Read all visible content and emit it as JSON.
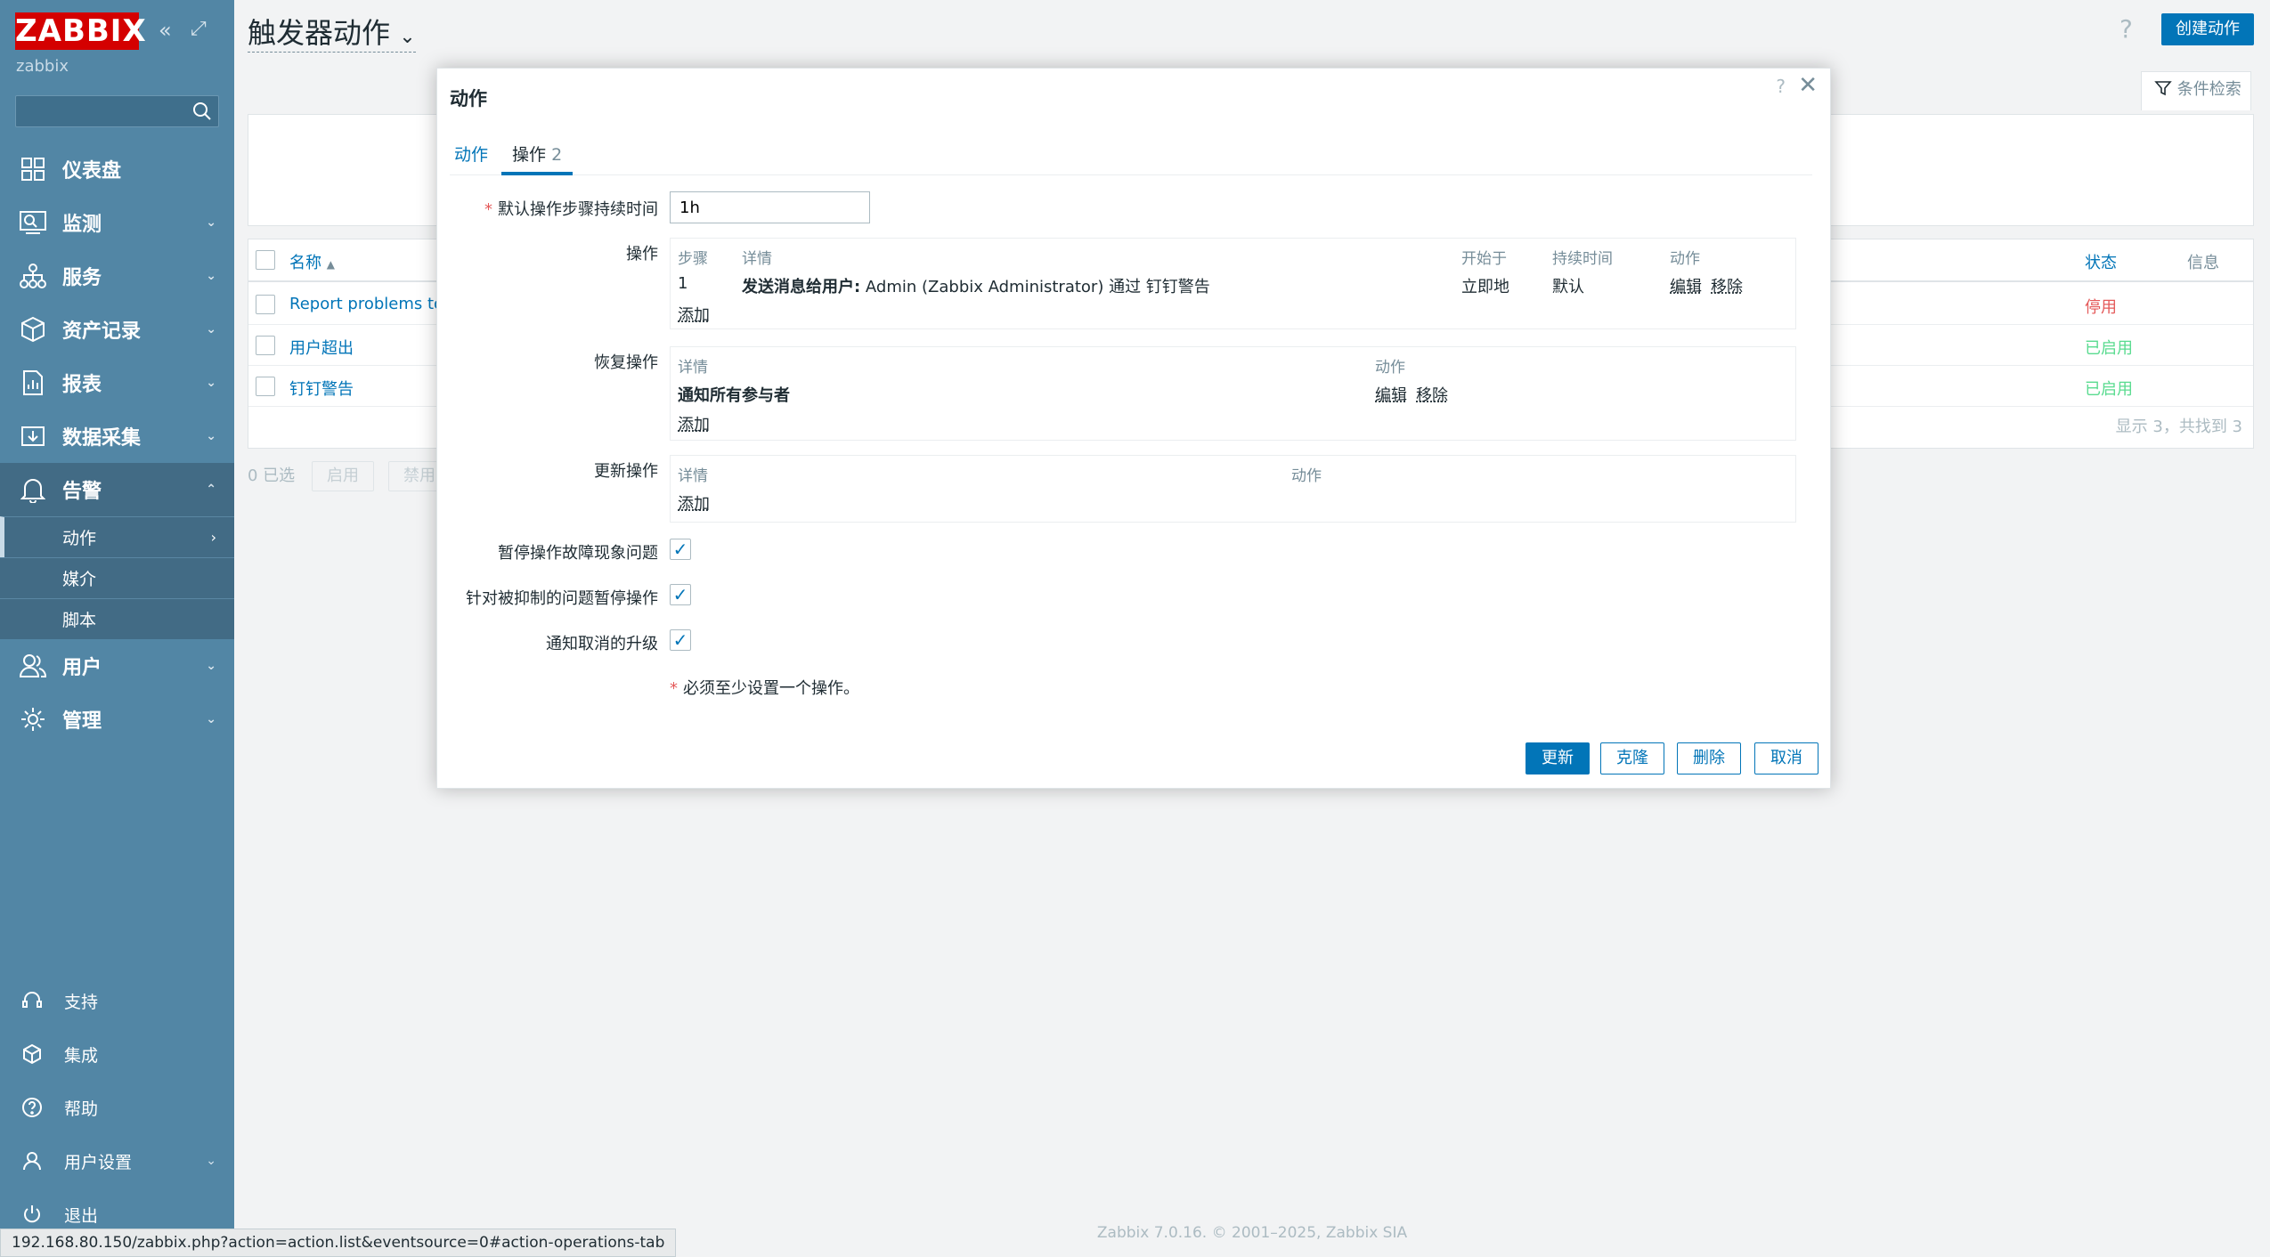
{
  "sidebar": {
    "logo": "ZABBIX",
    "server_name": "zabbix",
    "search_placeholder": "",
    "menu": [
      {
        "label": "仪表盘"
      },
      {
        "label": "监测"
      },
      {
        "label": "服务"
      },
      {
        "label": "资产记录"
      },
      {
        "label": "报表"
      },
      {
        "label": "数据采集"
      },
      {
        "label": "告警"
      },
      {
        "label": "用户"
      },
      {
        "label": "管理"
      }
    ],
    "alerts_submenu": [
      {
        "label": "动作"
      },
      {
        "label": "媒介"
      },
      {
        "label": "脚本"
      }
    ],
    "bottom": [
      {
        "label": "支持"
      },
      {
        "label": "集成"
      },
      {
        "label": "帮助"
      },
      {
        "label": "用户设置"
      },
      {
        "label": "退出"
      }
    ]
  },
  "header": {
    "title": "触发器动作",
    "help": "?",
    "create_button": "创建动作",
    "filter_tab": "条件检索"
  },
  "list": {
    "col_name": "名称",
    "col_status": "状态",
    "col_info": "信息",
    "rows": [
      {
        "name": "Report problems to Z",
        "status": "停用"
      },
      {
        "name": "用户超出",
        "status": "已启用"
      },
      {
        "name": "钉钉警告",
        "status": "已启用"
      }
    ],
    "count_text": "显示 3，共找到 3",
    "selected_text": "0 已选",
    "enable_button": "启用",
    "disable_button": "禁用"
  },
  "dialog": {
    "title": "动作",
    "help": "?",
    "close": "✕",
    "tabs": [
      {
        "label": "动作",
        "count": ""
      },
      {
        "label": "操作",
        "count": "2"
      }
    ],
    "default_step_label": "默认操作步骤持续时间",
    "default_step_value": "1h",
    "operations": {
      "label": "操作",
      "headers": {
        "step": "步骤",
        "details": "详情",
        "start": "开始于",
        "duration": "持续时间",
        "action": "动作"
      },
      "rows": [
        {
          "step": "1",
          "details_bold": "发送消息给用户:",
          "details_rest": " Admin (Zabbix Administrator) 通过 钉钉警告",
          "start": "立即地",
          "duration": "默认",
          "edit": "编辑",
          "remove": "移除"
        }
      ],
      "add": "添加"
    },
    "recovery": {
      "label": "恢复操作",
      "headers": {
        "details": "详情",
        "action": "动作"
      },
      "rows": [
        {
          "details": "通知所有参与者",
          "edit": "编辑",
          "remove": "移除"
        }
      ],
      "add": "添加"
    },
    "update_ops": {
      "label": "更新操作",
      "headers": {
        "details": "详情",
        "action": "动作"
      },
      "add": "添加"
    },
    "checkboxes": [
      {
        "label": "暂停操作故障现象问题",
        "checked": true
      },
      {
        "label": "针对被抑制的问题暂停操作",
        "checked": true
      },
      {
        "label": "通知取消的升级",
        "checked": true
      }
    ],
    "note": "必须至少设置一个操作。",
    "buttons": {
      "update": "更新",
      "clone": "克隆",
      "delete": "删除",
      "cancel": "取消"
    }
  },
  "footer": "Zabbix 7.0.16. © 2001–2025, Zabbix SIA",
  "statusbar_url": "192.168.80.150/zabbix.php?action=action.list&eventsource=0#action-operations-tab",
  "colors": {
    "sidebar": "#5286a5",
    "accent": "#0275b8",
    "logo": "#d40000",
    "disabled": "#e45959",
    "enabled": "#59db8f"
  }
}
